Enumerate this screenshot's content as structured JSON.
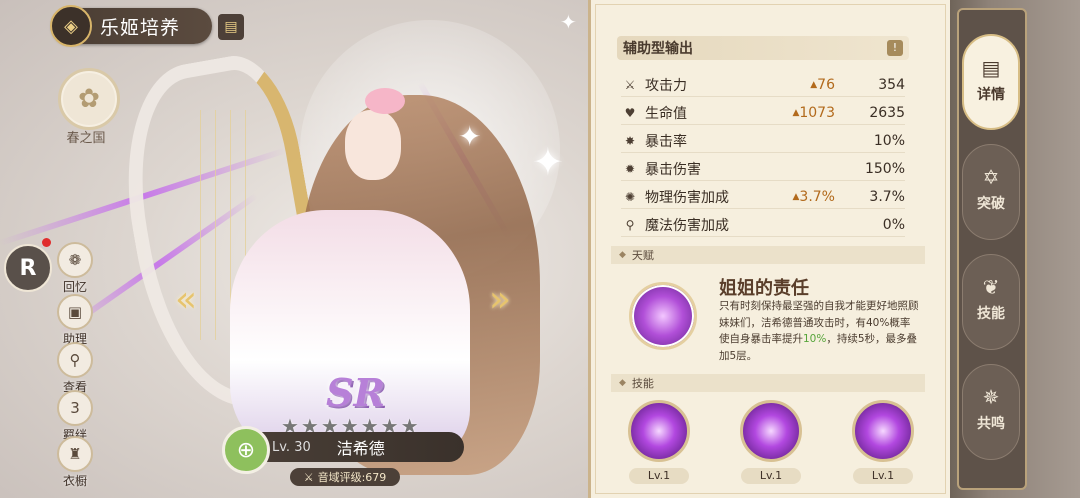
{
  "header": {
    "title": "乐姬培养",
    "emblem_icon": "diamond-emblem-icon",
    "codex_icon": "book-icon"
  },
  "faction": {
    "label": "春之国",
    "icon": "flower-crest-icon"
  },
  "left_menu": [
    {
      "label": "回忆",
      "icon": "memory-icon"
    },
    {
      "label": "助理",
      "icon": "assistant-icon"
    },
    {
      "label": "查看",
      "icon": "magnify-icon"
    },
    {
      "label": "羁绊",
      "icon": "bond-icon",
      "badge": "3"
    },
    {
      "label": "衣橱",
      "icon": "wardrobe-icon"
    }
  ],
  "character": {
    "rarity": "SR",
    "stars_total": 7,
    "level": "Lv. 30",
    "name": "洁希德",
    "class_icon": "bow-class-icon",
    "rating_label": "音域评级:679"
  },
  "stats": {
    "header": "辅助型输出",
    "rows": [
      {
        "name": "攻击力",
        "bonus": "76",
        "value": "354",
        "icon": "sword-icon"
      },
      {
        "name": "生命值",
        "bonus": "1073",
        "value": "2635",
        "icon": "heart-icon"
      },
      {
        "name": "暴击率",
        "bonus": "",
        "value": "10%",
        "icon": "crit-rate-icon"
      },
      {
        "name": "暴击伤害",
        "bonus": "",
        "value": "150%",
        "icon": "crit-damage-icon"
      },
      {
        "name": "物理伤害加成",
        "bonus": "3.7%",
        "value": "3.7%",
        "icon": "physical-icon"
      },
      {
        "name": "魔法伤害加成",
        "bonus": "",
        "value": "0%",
        "icon": "magic-icon"
      }
    ]
  },
  "talent": {
    "section_label": "天赋",
    "title": "姐姐的责任",
    "desc_before": "只有时刻保持最坚强的自我才能更好地照顾妹妹们，洁希德普通攻击时，有40%概率使自身暴击率提升",
    "desc_highlight": "10%",
    "desc_after": "，持续5秒，最多叠加5层。"
  },
  "skills": {
    "section_label": "技能",
    "items": [
      {
        "level": "Lv.1"
      },
      {
        "level": "Lv.1"
      },
      {
        "level": "Lv.1"
      }
    ]
  },
  "tabs": [
    {
      "label": "详情",
      "icon": "scroll-icon",
      "active": true
    },
    {
      "label": "突破",
      "icon": "star-break-icon",
      "active": false
    },
    {
      "label": "技能",
      "icon": "wings-icon",
      "active": false
    },
    {
      "label": "共鸣",
      "icon": "resonance-icon",
      "active": false
    }
  ]
}
